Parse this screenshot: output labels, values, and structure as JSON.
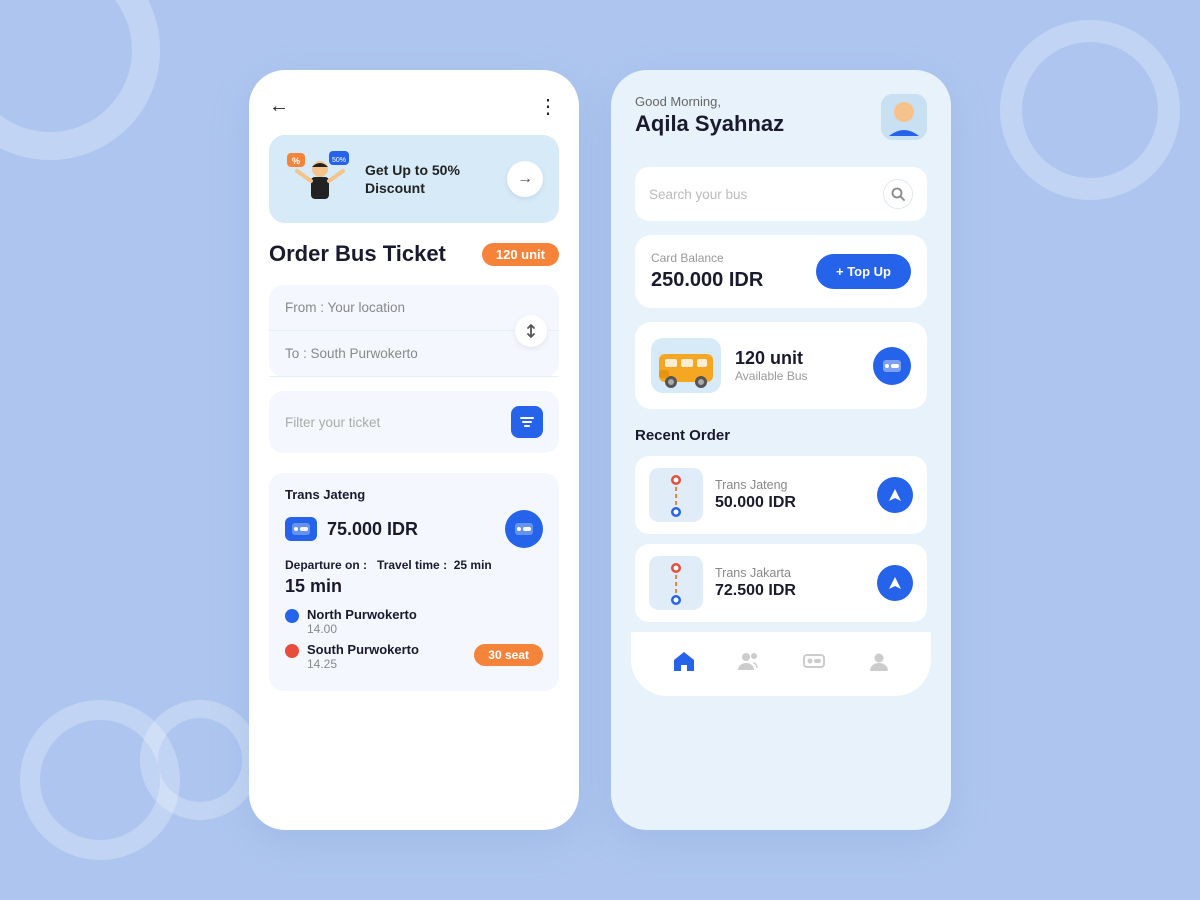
{
  "background_color": "#aec6ef",
  "left_phone": {
    "back_label": "←",
    "more_label": "⋮",
    "banner": {
      "text": "Get Up to 50% Discount",
      "arrow": "→"
    },
    "order_title": "Order Bus Ticket",
    "unit_badge": "120 unit",
    "from_label": "From : Your location",
    "to_label": "To : South Purwokerto",
    "filter_label": "Filter your ticket",
    "ticket": {
      "operator": "Trans Jateng",
      "price": "75.000 IDR",
      "departure_label": "Departure on :",
      "travel_label": "Travel time :",
      "travel_time": "25 min",
      "wait_time": "15 min",
      "stop1_name": "North Purwokerto",
      "stop1_time": "14.00",
      "stop2_name": "South Purwokerto",
      "stop2_time": "14.25",
      "seat_badge": "30 seat"
    }
  },
  "right_phone": {
    "greeting": "Good Morning,",
    "user_name": "Aqila Syahnaz",
    "search_placeholder": "Search your bus",
    "card_balance_label": "Card Balance",
    "card_balance_amount": "250.000 IDR",
    "topup_label": "+ Top Up",
    "bus_units": "120 unit",
    "bus_available_label": "Available Bus",
    "recent_title": "Recent Order",
    "orders": [
      {
        "operator": "Trans Jateng",
        "price": "50.000 IDR"
      },
      {
        "operator": "Trans Jakarta",
        "price": "72.500 IDR"
      }
    ],
    "nav_items": [
      "home",
      "people",
      "ticket",
      "person"
    ]
  }
}
